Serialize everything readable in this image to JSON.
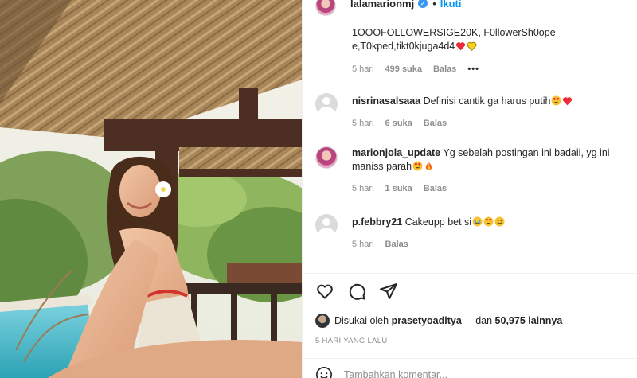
{
  "post": {
    "username": "lalamarionmj",
    "follow_label": "Ikuti",
    "dot": "•"
  },
  "comments": [
    {
      "text": "1OOOFOLLOWERSIGE20K, F0llowerSh0ope",
      "text2": "e,T0kped,tikt0kjuga4d4",
      "time": "5 hari",
      "likes": "499 suka",
      "reply": "Balas",
      "more": "•••"
    },
    {
      "username": "nisrinasalsaaa",
      "text": "Definisi cantik ga harus putih",
      "time": "5 hari",
      "likes": "6 suka",
      "reply": "Balas"
    },
    {
      "username": "marionjola_update",
      "text": "Yg sebelah postingan ini badaii, yg ini",
      "text2": "maniss parah",
      "time": "5 hari",
      "likes": "1 suka",
      "reply": "Balas"
    },
    {
      "username": "p.febbry21",
      "text": "Cakeupp bet si",
      "time": "5 hari",
      "reply": "Balas"
    }
  ],
  "actions": {
    "like_icon": "heart-outline-icon",
    "comment_icon": "comment-bubble-icon",
    "share_icon": "paper-plane-icon"
  },
  "likes": {
    "prefix": "Disukai oleh",
    "user": "prasetyoaditya__",
    "connector": "dan",
    "others": "50,975 lainnya"
  },
  "date": "5 HARI YANG LALU",
  "add_comment": {
    "placeholder": "Tambahkan komentar..."
  },
  "colors": {
    "accent": "#0095f6",
    "secondary_text": "#8e8e8e",
    "heart": "#ed2a3a",
    "yellow_heart": "#f7d21c"
  }
}
